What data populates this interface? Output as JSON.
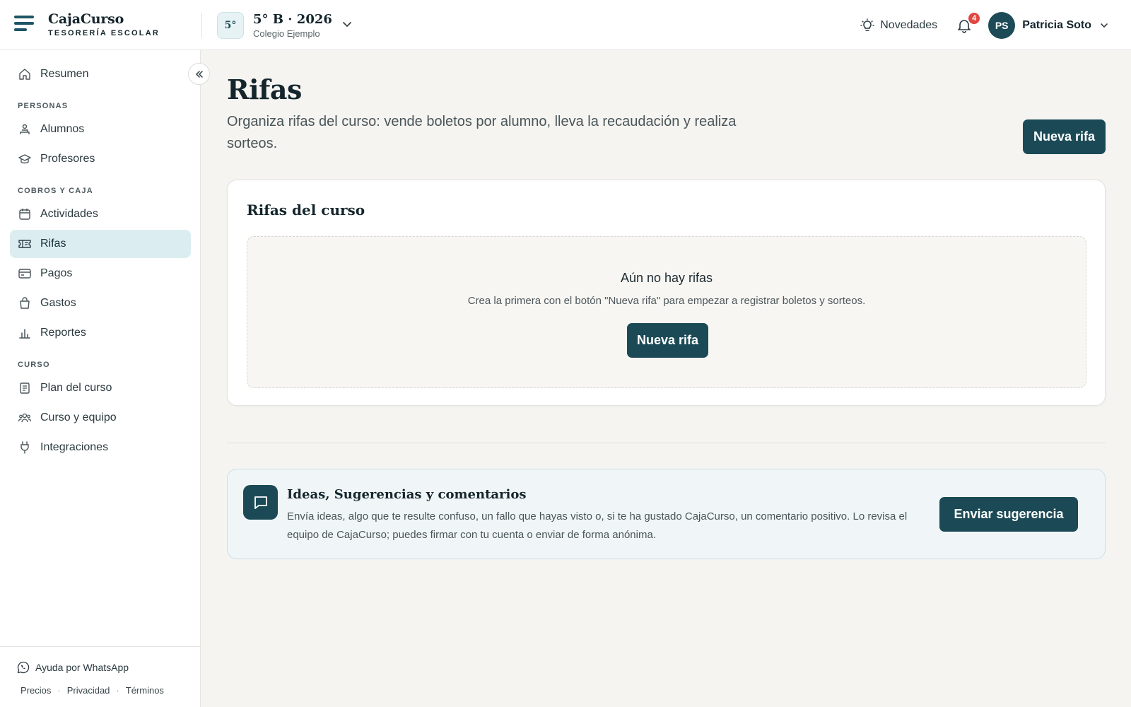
{
  "brand": {
    "name": "CajaCurso",
    "tagline": "TESORERÍA ESCOLAR"
  },
  "course": {
    "badge": "5°",
    "title": "5° B · 2026",
    "school": "Colegio Ejemplo"
  },
  "header": {
    "news_label": "Novedades",
    "notifications_count": "4",
    "user_initials": "PS",
    "user_name": "Patricia Soto"
  },
  "sidebar": {
    "summary": "Resumen",
    "section_people": "PERSONAS",
    "students": "Alumnos",
    "teachers": "Profesores",
    "section_billing": "COBROS Y CAJA",
    "activities": "Actividades",
    "raffles": "Rifas",
    "payments": "Pagos",
    "expenses": "Gastos",
    "reports": "Reportes",
    "section_course": "CURSO",
    "course_plan": "Plan del curso",
    "course_team": "Curso y equipo",
    "integrations": "Integraciones",
    "active_item": "Rifas"
  },
  "footer": {
    "whatsapp": "Ayuda por WhatsApp",
    "pricing": "Precios",
    "privacy": "Privacidad",
    "terms": "Términos",
    "separator": "·"
  },
  "page": {
    "title": "Rifas",
    "description": "Organiza rifas del curso: vende boletos por alumno, lleva la recaudación y realiza sorteos.",
    "new_button": "Nueva rifa"
  },
  "raffles_card": {
    "title": "Rifas del curso",
    "empty_title": "Aún no hay rifas",
    "empty_desc": "Crea la primera con el botón \"Nueva rifa\" para empezar a registrar boletos y sorteos.",
    "empty_button": "Nueva rifa"
  },
  "feedback": {
    "title": "Ideas, Sugerencias y comentarios",
    "description": "Envía ideas, algo que te resulte confuso, un fallo que hayas visto o, si te ha gustado CajaCurso, un comentario positivo. Lo revisa el equipo de CajaCurso; puedes firmar con tu cuenta o enviar de forma anónima.",
    "button": "Enviar sugerencia"
  },
  "colors": {
    "primary": "#1b4a56",
    "active_bg": "#dcedf1",
    "badge": "#e0473f",
    "page_bg": "#f5f4f1"
  }
}
